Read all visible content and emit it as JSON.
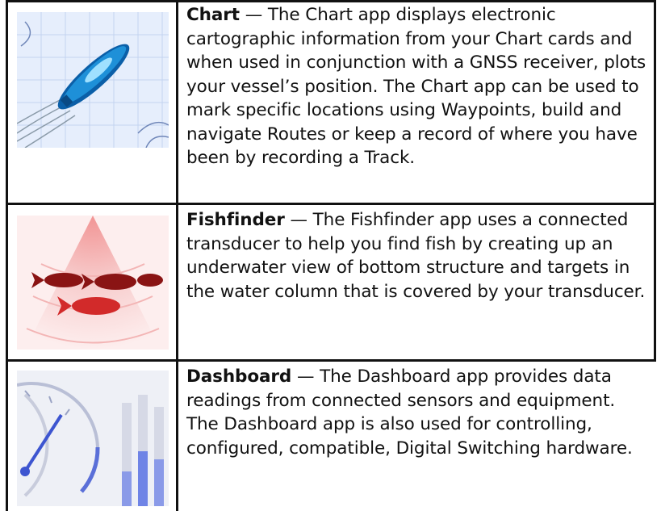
{
  "rows": [
    {
      "icon": "chart-app-icon",
      "title": "Chart",
      "dash": " — ",
      "text": "The Chart app displays electronic cartographic information from your Chart cards and when used in conjunction with a GNSS receiver, plots your vessel’s position. The Chart app can be used to mark specific locations using Waypoints, build and navigate Routes or keep a record of where you have been by recording a Track."
    },
    {
      "icon": "fishfinder-app-icon",
      "title": "Fishfinder",
      "dash": " — ",
      "text": "The Fishfinder app uses a connected transducer to help you find fish by creating up an underwater view of bottom structure and targets in the water column that is covered by your transducer."
    },
    {
      "icon": "dashboard-app-icon",
      "title": "Dashboard",
      "dash": " — ",
      "text": "The Dashboard app provides data readings from connected sensors and equipment. The Dashboard app is also used for controlling, configured, compatible, Digital Switching hardware."
    }
  ],
  "colors": {
    "chart_bg": "#e6eefc",
    "boat": "#1e90d8",
    "fish": "#b01818",
    "sonar": "#f7c9c9",
    "gauge": "#5a6fd8"
  }
}
